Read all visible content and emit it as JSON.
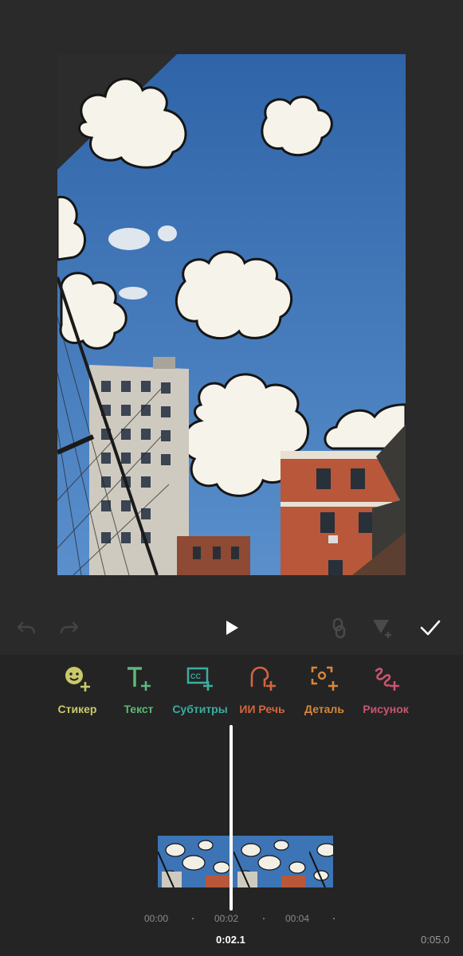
{
  "preview": {
    "description_icon": "video-frame"
  },
  "controls": {
    "undo_icon": "undo-icon",
    "redo_icon": "redo-icon",
    "play_icon": "play-icon",
    "link_icon": "link-icon",
    "keyframe_icon": "keyframe-add-icon",
    "confirm_icon": "checkmark-icon"
  },
  "tools": [
    {
      "label": "Стикер",
      "icon": "sticker-add-icon",
      "color": "#c9c96a"
    },
    {
      "label": "Текст",
      "icon": "text-add-icon",
      "color": "#5cb87a"
    },
    {
      "label": "Субтитры",
      "icon": "subtitles-add-icon",
      "color": "#3aaea0"
    },
    {
      "label": "ИИ Речь",
      "icon": "ai-speech-add-icon",
      "color": "#d4653f"
    },
    {
      "label": "Деталь",
      "icon": "detail-add-icon",
      "color": "#d9853b"
    },
    {
      "label": "Рисунок",
      "icon": "draw-add-icon",
      "color": "#c9556f"
    }
  ],
  "timeline": {
    "ruler": [
      "00:00",
      "00:02",
      "00:04"
    ],
    "current_time": "0:02.1",
    "total_time": "0:05.0"
  }
}
